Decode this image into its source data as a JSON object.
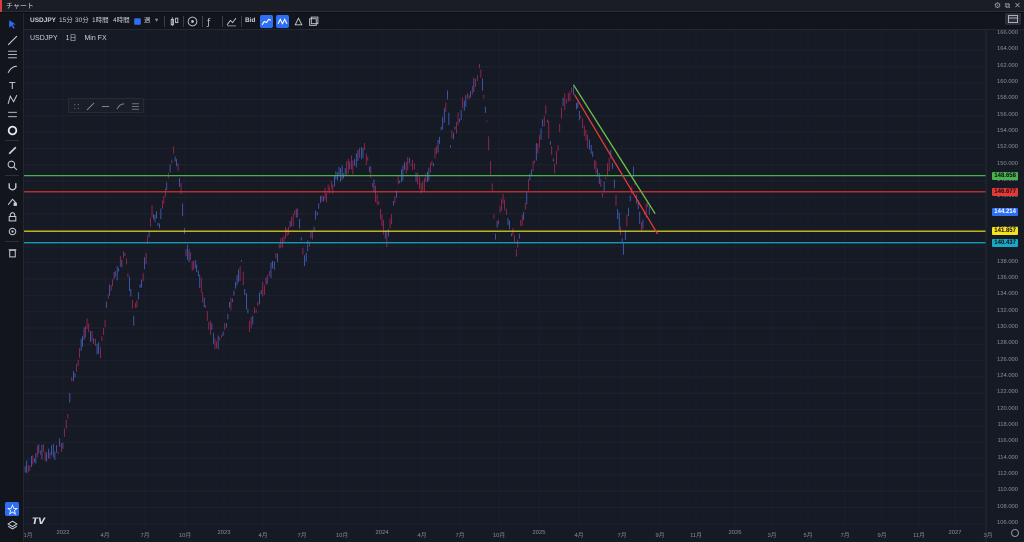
{
  "window": {
    "title": "チャート"
  },
  "toolbar": {
    "symbol": "USDJPY",
    "intervals": [
      "15分",
      "30分",
      "1時間",
      "4時間"
    ],
    "period_selected": "週",
    "bid_label": "Bid"
  },
  "chart_header": {
    "symbol": "USDJPY",
    "interval": "1日",
    "source": "Min FX"
  },
  "y_axis": {
    "ticks": [
      "164.000",
      "162.000",
      "160.000",
      "158.000",
      "156.000",
      "154.000",
      "152.000",
      "150.000",
      "148.000",
      "146.000",
      "144.000",
      "142.000",
      "140.000",
      "138.000",
      "136.000",
      "134.000",
      "132.000",
      "130.000",
      "128.000",
      "126.000",
      "124.000",
      "122.000",
      "120.000",
      "118.000",
      "116.000",
      "114.000",
      "112.000",
      "110.000",
      "108.000",
      "106.000"
    ],
    "top_label": "166.000"
  },
  "x_axis": {
    "ticks": [
      "1月",
      "2022",
      "4月",
      "7月",
      "10月",
      "2023",
      "4月",
      "7月",
      "10月",
      "2024",
      "4月",
      "7月",
      "10月",
      "2025",
      "4月",
      "7月",
      "9月",
      "11月",
      "2026",
      "3月",
      "5月",
      "7月",
      "9月",
      "11月",
      "2027",
      "3月"
    ]
  },
  "price_levels": [
    {
      "value": "148.658",
      "color": "#4caf50"
    },
    {
      "value": "146.677",
      "color": "#e53935"
    },
    {
      "value": "144.214",
      "color": "#2e6ef5"
    },
    {
      "value": "141.857",
      "color": "#f6e21c"
    },
    {
      "value": "140.437",
      "color": "#17a8c4"
    }
  ],
  "axis_overlay_labels": {
    "green_sub": "148.000",
    "red_sub": "146.000"
  },
  "chart_data": {
    "type": "line",
    "title": "",
    "xlabel": "",
    "ylabel": "",
    "ylim": [
      105.5,
      166.5
    ],
    "series": [
      {
        "values": [
          {
            "date": "2021-12",
            "value": 111.0
          },
          {
            "date": "2022-01-05",
            "value": 113.5
          },
          {
            "date": "2022-01-20",
            "value": 115.0
          },
          {
            "date": "2022-02-05",
            "value": 114.5
          },
          {
            "date": "2022-02-25",
            "value": 115.0
          },
          {
            "date": "2022-03-10",
            "value": 116.0
          },
          {
            "date": "2022-03-20",
            "value": 119.5
          },
          {
            "date": "2022-03-28",
            "value": 123.5
          },
          {
            "date": "2022-04-10",
            "value": 126.0
          },
          {
            "date": "2022-04-28",
            "value": 130.5
          },
          {
            "date": "2022-05-15",
            "value": 128.0
          },
          {
            "date": "2022-05-25",
            "value": 127.0
          },
          {
            "date": "2022-06-10",
            "value": 134.0
          },
          {
            "date": "2022-06-25",
            "value": 136.5
          },
          {
            "date": "2022-07-14",
            "value": 139.0
          },
          {
            "date": "2022-08-01",
            "value": 131.5
          },
          {
            "date": "2022-08-20",
            "value": 136.5
          },
          {
            "date": "2022-09-07",
            "value": 144.5
          },
          {
            "date": "2022-09-22",
            "value": 143.0
          },
          {
            "date": "2022-10-10",
            "value": 148.5
          },
          {
            "date": "2022-10-21",
            "value": 151.9
          },
          {
            "date": "2022-11-05",
            "value": 147.0
          },
          {
            "date": "2022-11-15",
            "value": 139.5
          },
          {
            "date": "2022-12-10",
            "value": 137.0
          },
          {
            "date": "2022-12-25",
            "value": 132.0
          },
          {
            "date": "2023-01-16",
            "value": 127.5
          },
          {
            "date": "2023-02-05",
            "value": 131.0
          },
          {
            "date": "2023-03-08",
            "value": 137.5
          },
          {
            "date": "2023-03-24",
            "value": 130.5
          },
          {
            "date": "2023-04-20",
            "value": 134.5
          },
          {
            "date": "2023-05-30",
            "value": 140.5
          },
          {
            "date": "2023-06-30",
            "value": 144.5
          },
          {
            "date": "2023-07-14",
            "value": 138.0
          },
          {
            "date": "2023-08-15",
            "value": 145.5
          },
          {
            "date": "2023-09-25",
            "value": 149.0
          },
          {
            "date": "2023-10-20",
            "value": 150.0
          },
          {
            "date": "2023-11-13",
            "value": 151.9
          },
          {
            "date": "2023-12-05",
            "value": 146.5
          },
          {
            "date": "2023-12-28",
            "value": 140.8
          },
          {
            "date": "2024-01-20",
            "value": 148.0
          },
          {
            "date": "2024-02-15",
            "value": 150.5
          },
          {
            "date": "2024-03-10",
            "value": 147.0
          },
          {
            "date": "2024-04-10",
            "value": 152.0
          },
          {
            "date": "2024-04-29",
            "value": 158.4
          },
          {
            "date": "2024-05-05",
            "value": 152.8
          },
          {
            "date": "2024-05-30",
            "value": 157.0
          },
          {
            "date": "2024-06-25",
            "value": 160.0
          },
          {
            "date": "2024-07-03",
            "value": 161.9
          },
          {
            "date": "2024-07-15",
            "value": 157.5
          },
          {
            "date": "2024-08-05",
            "value": 141.7
          },
          {
            "date": "2024-08-20",
            "value": 146.0
          },
          {
            "date": "2024-09-16",
            "value": 139.6
          },
          {
            "date": "2024-10-01",
            "value": 144.0
          },
          {
            "date": "2024-10-20",
            "value": 150.0
          },
          {
            "date": "2024-11-15",
            "value": 156.5
          },
          {
            "date": "2024-12-03",
            "value": 149.5
          },
          {
            "date": "2024-12-20",
            "value": 157.5
          },
          {
            "date": "2025-01-10",
            "value": 158.8
          },
          {
            "date": "2025-01-25",
            "value": 155.5
          },
          {
            "date": "2025-02-15",
            "value": 152.0
          },
          {
            "date": "2025-03-10",
            "value": 146.6
          },
          {
            "date": "2025-03-27",
            "value": 151.0
          },
          {
            "date": "2025-04-10",
            "value": 144.0
          },
          {
            "date": "2025-04-22",
            "value": 139.9
          },
          {
            "date": "2025-05-12",
            "value": 148.6
          },
          {
            "date": "2025-05-28",
            "value": 142.5
          },
          {
            "date": "2025-06-10",
            "value": 144.9
          },
          {
            "date": "2025-06-16",
            "value": 144.2
          }
        ]
      }
    ],
    "trendlines": [
      {
        "color": "#6fc34a",
        "from": {
          "date": "2025-01-10",
          "value": 159.8
        },
        "to": {
          "date": "2025-06-25",
          "value": 144.0
        }
      },
      {
        "color": "#e53935",
        "from": {
          "date": "2025-01-13",
          "value": 158.5
        },
        "to": {
          "date": "2025-06-30",
          "value": 141.5
        }
      }
    ]
  },
  "sidebar_icons": [
    "cursor-icon",
    "trendline-icon",
    "fib-icon",
    "brush-icon",
    "text-icon",
    "pattern-icon",
    "measure-icon",
    "circle-icon",
    "ruler-icon",
    "zoom-icon",
    "magnet-icon",
    "lock-draw-icon",
    "lock-icon",
    "visibility-icon",
    "trash-icon",
    "favorites-icon",
    "layers-icon"
  ]
}
